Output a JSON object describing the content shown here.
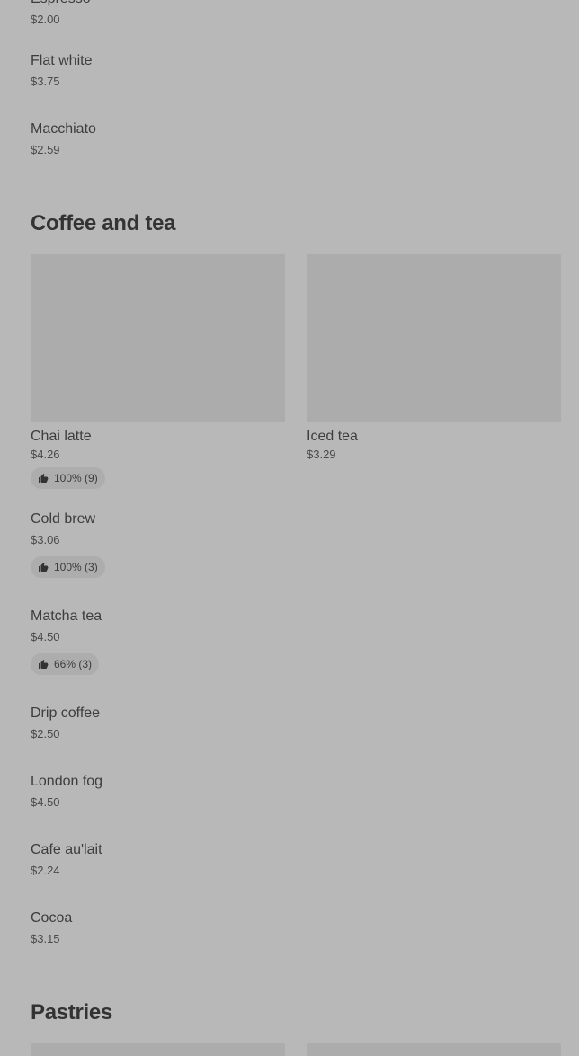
{
  "top_items": [
    {
      "name": "Espresso",
      "price": "$2.00"
    },
    {
      "name": "Flat white",
      "price": "$3.75"
    },
    {
      "name": "Macchiato",
      "price": "$2.59"
    }
  ],
  "coffee_and_tea": {
    "title": "Coffee and tea",
    "featured": [
      {
        "name": "Chai latte",
        "price": "$4.26",
        "rating": "100% (9)"
      },
      {
        "name": "Iced tea",
        "price": "$3.29"
      }
    ],
    "items": [
      {
        "name": "Cold brew",
        "price": "$3.06",
        "rating": "100% (3)"
      },
      {
        "name": "Matcha tea",
        "price": "$4.50",
        "rating": "66% (3)"
      },
      {
        "name": "Drip coffee",
        "price": "$2.50"
      },
      {
        "name": "London fog",
        "price": "$4.50"
      },
      {
        "name": "Cafe au'lait",
        "price": "$2.24"
      },
      {
        "name": "Cocoa",
        "price": "$3.15"
      }
    ]
  },
  "pastries": {
    "title": "Pastries"
  },
  "icons": {
    "rating_icon": "thumbs-up-icon"
  },
  "colors": {
    "background": "#b8b8b8",
    "image_placeholder": "#acacac",
    "rating_pill": "#adadad"
  }
}
